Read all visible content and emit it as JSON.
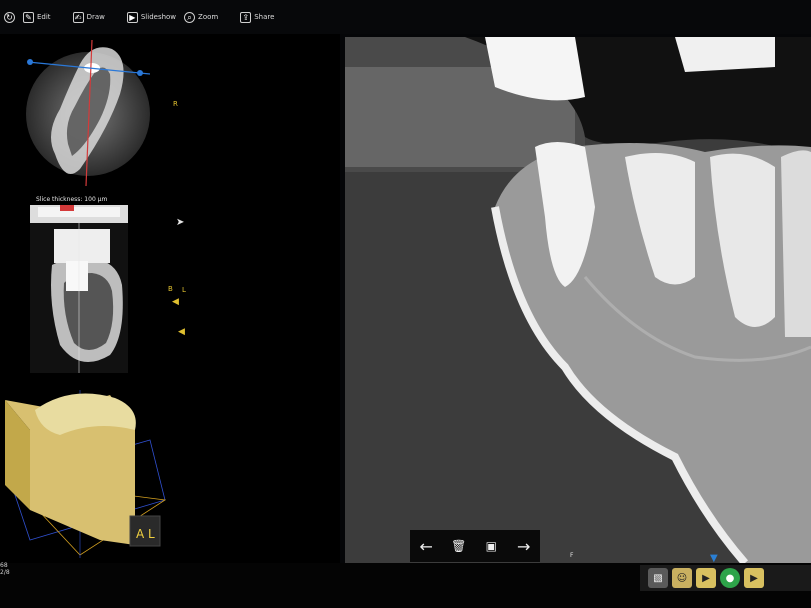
{
  "toolbar": {
    "items": [
      {
        "label": "Edit",
        "icon": "pencil-icon"
      },
      {
        "label": "Draw",
        "icon": "draw-icon"
      },
      {
        "label": "Slideshow",
        "icon": "slideshow-icon"
      },
      {
        "label": "Zoom",
        "icon": "zoom-icon"
      },
      {
        "label": "Share",
        "icon": "share-icon"
      }
    ]
  },
  "left_panel": {
    "orientation_r": "R",
    "slice_thickness": "Slice thickness: 100 µm",
    "orientation_b": "B",
    "orientation_l": "L",
    "cube_face": "A L"
  },
  "main_view": {
    "marker_f": "F"
  },
  "nav": {
    "prev_label": "←",
    "delete_label": "🗑",
    "fit_label": "▣",
    "next_label": "→"
  },
  "status": {
    "line1": "68",
    "line2": "2/8"
  },
  "colors": {
    "accent": "#e0c030",
    "background": "#050608",
    "taskbar": "#1a1a1a"
  }
}
